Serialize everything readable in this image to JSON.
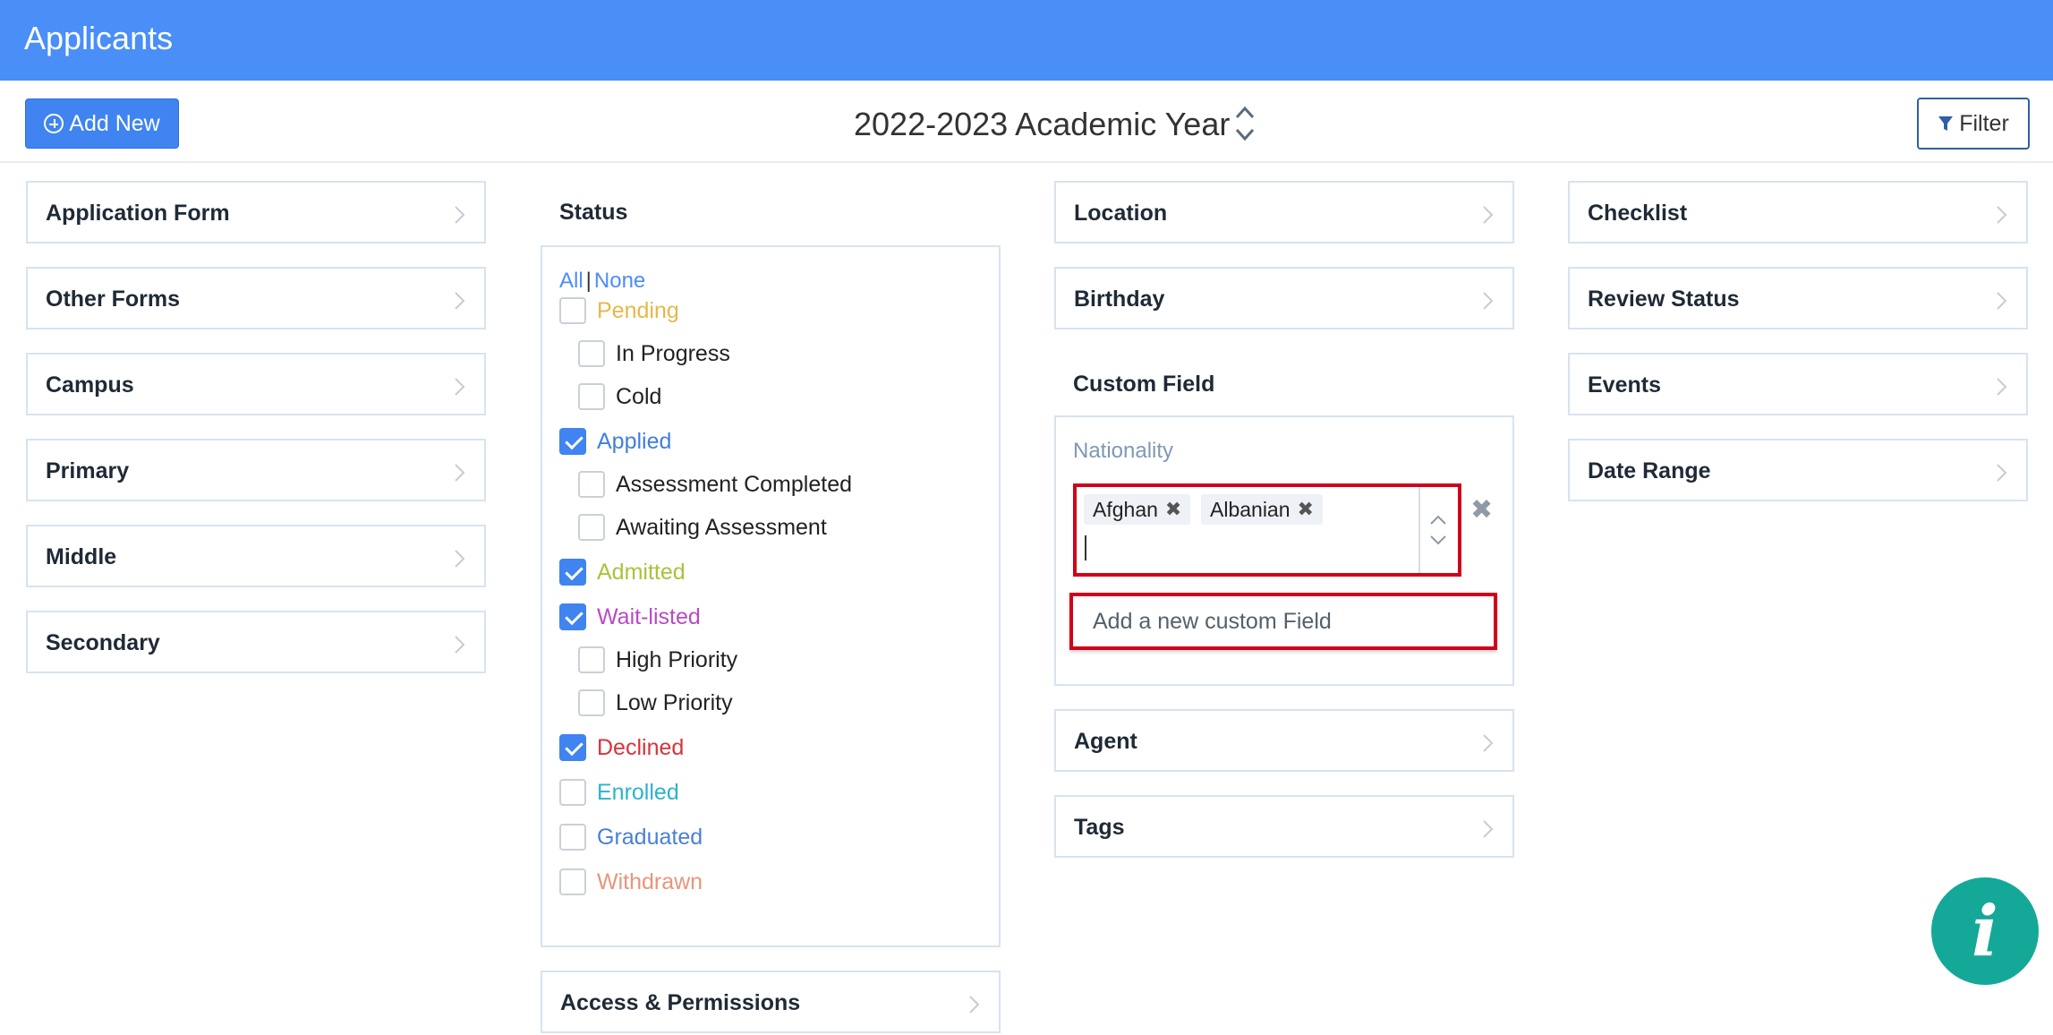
{
  "header": {
    "title": "Applicants"
  },
  "toolbar": {
    "add_label": "Add New",
    "academic_year": "2022-2023 Academic Year",
    "filter_label": "Filter"
  },
  "column1": {
    "panels": [
      "Application Form",
      "Other Forms",
      "Campus",
      "Primary",
      "Middle",
      "Secondary"
    ]
  },
  "status": {
    "title": "Status",
    "all": "All",
    "sep": "|",
    "none": "None",
    "items": [
      {
        "label": "Pending",
        "checked": false,
        "color": "#e6b84a"
      },
      {
        "label": "In Progress",
        "checked": false,
        "color": "#222222"
      },
      {
        "label": "Cold",
        "checked": false,
        "color": "#222222"
      },
      {
        "label": "Applied",
        "checked": true,
        "color": "#3f7fe0"
      },
      {
        "label": "Assessment Completed",
        "checked": false,
        "color": "#222222"
      },
      {
        "label": "Awaiting Assessment",
        "checked": false,
        "color": "#222222"
      },
      {
        "label": "Admitted",
        "checked": true,
        "color": "#a8c33a"
      },
      {
        "label": "Wait-listed",
        "checked": true,
        "color": "#b84ac4"
      },
      {
        "label": "High Priority",
        "checked": false,
        "color": "#222222"
      },
      {
        "label": "Low Priority",
        "checked": false,
        "color": "#222222"
      },
      {
        "label": "Declined",
        "checked": true,
        "color": "#d8323a"
      },
      {
        "label": "Enrolled",
        "checked": false,
        "color": "#2bb3cc"
      },
      {
        "label": "Graduated",
        "checked": false,
        "color": "#4a7fd8"
      },
      {
        "label": "Withdrawn",
        "checked": false,
        "color": "#e8957a"
      }
    ],
    "access_label": "Access & Permissions"
  },
  "column3": {
    "panels_top": [
      "Location",
      "Birthday"
    ],
    "custom_field": {
      "title": "Custom Field",
      "field_label": "Nationality",
      "selected": [
        "Afghan",
        "Albanian"
      ],
      "tag_remove": "✖",
      "clear": "✖",
      "add_new": "Add a new custom Field"
    },
    "panels_bottom": [
      "Agent",
      "Tags"
    ]
  },
  "column4": {
    "panels": [
      "Checklist",
      "Review Status",
      "Events",
      "Date Range"
    ]
  },
  "info_button": {
    "label": "i"
  },
  "colors": {
    "header_bg": "#4a8ef8",
    "accent": "#3f84f0",
    "highlight_border": "#d0021b",
    "info_bg": "#14a898"
  }
}
